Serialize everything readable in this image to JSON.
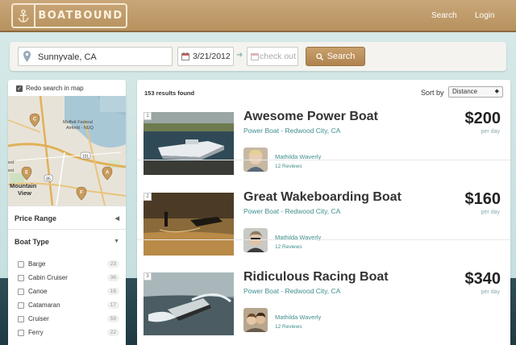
{
  "header": {
    "logo_text": "BOATBOUND",
    "nav": {
      "search": "Search",
      "login": "Login"
    }
  },
  "search": {
    "location_value": "Sunnyvale, CA",
    "checkin_value": "3/21/2012",
    "checkout_placeholder": "check out",
    "button_label": "Search"
  },
  "sidebar": {
    "redo_search_label": "Redo search in map",
    "map_labels": [
      "Moffett Federal Airfield - NUQ",
      "Mountain View",
      "est",
      "est",
      "101",
      "85"
    ],
    "map_markers": [
      "C",
      "E",
      "A",
      "F"
    ],
    "price_range_label": "Price Range",
    "boat_type_label": "Boat Type",
    "boat_types": [
      {
        "label": "Barge",
        "count": "23"
      },
      {
        "label": "Cabin Cruiser",
        "count": "36"
      },
      {
        "label": "Canoe",
        "count": "16"
      },
      {
        "label": "Catamaran",
        "count": "17"
      },
      {
        "label": "Cruiser",
        "count": "59"
      },
      {
        "label": "Ferry",
        "count": "22"
      }
    ]
  },
  "results": {
    "count_text": "153 results found",
    "sort_label": "Sort by",
    "sort_value": "Distance",
    "listings": [
      {
        "number": "1",
        "title": "Awesome Power Boat",
        "subtitle": "Power Boat - Redwood City, CA",
        "price": "$200",
        "per": "per day",
        "owner": "Mathilda Waverly",
        "reviews": "12 Reviews"
      },
      {
        "number": "2",
        "title": "Great Wakeboarding Boat",
        "subtitle": "Power Boat - Redwood City, CA",
        "price": "$160",
        "per": "per day",
        "owner": "Mathilda Waverly",
        "reviews": "12 Reviews"
      },
      {
        "number": "3",
        "title": "Ridiculous Racing Boat",
        "subtitle": "Power Boat - Redwood City, CA",
        "price": "$340",
        "per": "per day",
        "owner": "Mathilda Waverly",
        "reviews": "12 Reviews"
      }
    ]
  },
  "colors": {
    "header_wood": "#b7925f",
    "accent_teal": "#3f8e8d",
    "search_button": "#b0834f"
  }
}
